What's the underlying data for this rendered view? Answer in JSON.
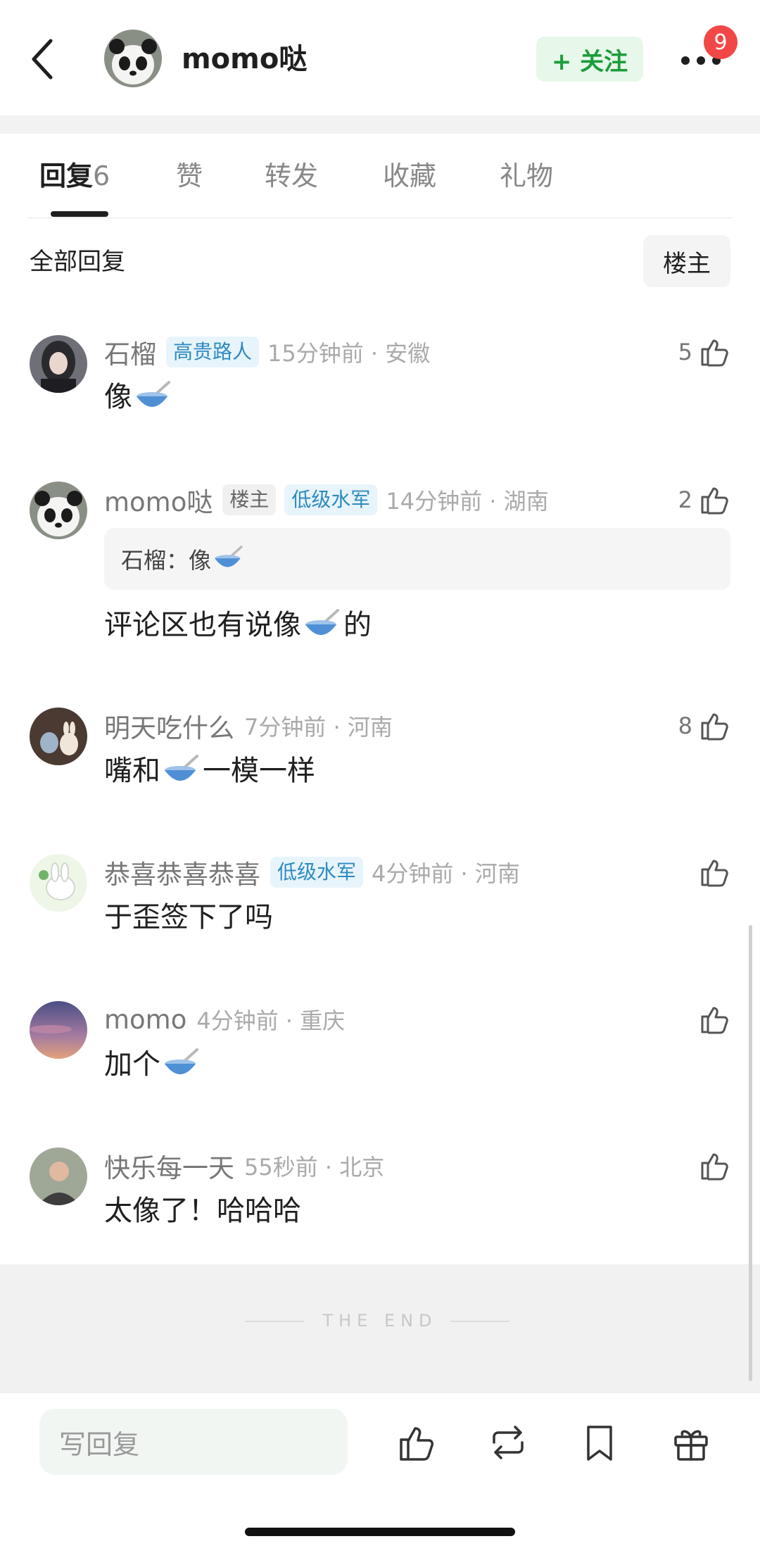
{
  "header": {
    "username": "momo哒",
    "follow_label": "+ 关注",
    "badge_count": "9"
  },
  "tabs": [
    {
      "label": "回复",
      "count": "6"
    },
    {
      "label": "赞"
    },
    {
      "label": "转发"
    },
    {
      "label": "收藏"
    },
    {
      "label": "礼物"
    }
  ],
  "filter": {
    "all_replies_label": "全部回复",
    "owner_button_label": "楼主"
  },
  "comments": [
    {
      "name": "石榴",
      "tags": [
        "高贵路人"
      ],
      "time": "15分钟前 · 安徽",
      "likes": "5",
      "text": "像"
    },
    {
      "name": "momo哒",
      "tags": [
        "楼主",
        "低级水军"
      ],
      "time": "14分钟前 · 湖南",
      "likes": "2",
      "quote": "石榴：像",
      "text_before": "评论区也有说像",
      "text_after": "的"
    },
    {
      "name": "明天吃什么",
      "tags": [],
      "time": "7分钟前 · 河南",
      "likes": "8",
      "text_before": "嘴和",
      "text_after": "一模一样"
    },
    {
      "name": "恭喜恭喜恭喜",
      "tags": [
        "低级水军"
      ],
      "time": "4分钟前 · 河南",
      "likes": "",
      "text": "于歪签下了吗"
    },
    {
      "name": "momo",
      "tags": [],
      "time": "4分钟前 · 重庆",
      "likes": "",
      "text": "加个"
    },
    {
      "name": "快乐每一天",
      "tags": [],
      "time": "55秒前 · 北京",
      "likes": "",
      "text": "太像了！哈哈哈"
    }
  ],
  "end_label": "THE END",
  "bottom": {
    "reply_placeholder": "写回复"
  },
  "icons": [
    "back-arrow-icon",
    "more-dots-icon",
    "thumbs-up-icon",
    "bowl-emoji-icon",
    "repost-icon",
    "bookmark-icon",
    "gift-icon"
  ],
  "colors": {
    "follow_green": "#1c9d3a",
    "follow_bg": "#e7f7ea",
    "badge_red": "#f24747",
    "tag_blue": "#2e8bc0"
  }
}
